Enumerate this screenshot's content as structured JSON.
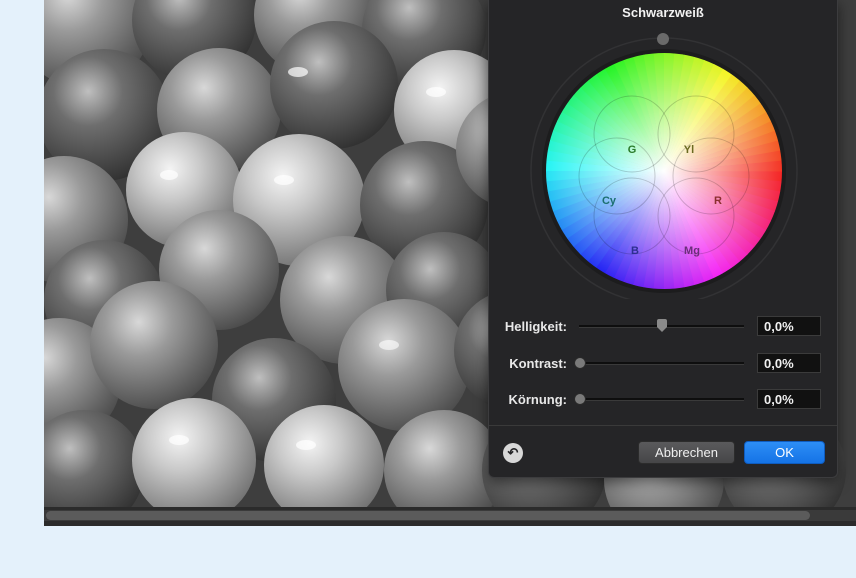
{
  "panel": {
    "title": "Schwarzweiß",
    "wheel": {
      "labels": {
        "g": "G",
        "yl": "Yl",
        "cy": "Cy",
        "r": "R",
        "b": "B",
        "mg": "Mg"
      }
    },
    "sliders": [
      {
        "label": "Helligkeit:",
        "value": "0,0%",
        "level": 0.5
      },
      {
        "label": "Kontrast:",
        "value": "0,0%",
        "level": 0.0
      },
      {
        "label": "Körnung:",
        "value": "0,0%",
        "level": 0.0
      }
    ],
    "buttons": {
      "cancel": "Abbrechen",
      "ok": "OK"
    },
    "reset_icon": "undo-arrow-icon"
  },
  "colors": {
    "accent": "#1a7be8",
    "panel_bg": "#252527",
    "page_bg": "#e4f1fb"
  }
}
